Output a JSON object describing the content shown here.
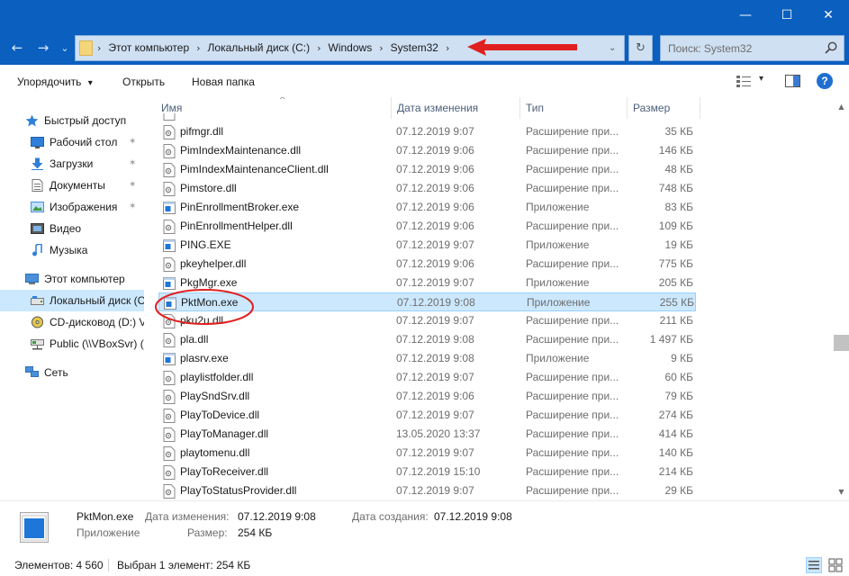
{
  "window": {
    "minimize_glyph": "—",
    "maximize_glyph": "☐",
    "close_glyph": "✕"
  },
  "nav": {
    "back_glyph": "←",
    "forward_glyph": "→",
    "recent_glyph": "⌄",
    "up_glyph": "↑"
  },
  "address": {
    "breadcrumbs": [
      "Этот компьютер",
      "Локальный диск (C:)",
      "Windows",
      "System32"
    ],
    "separator": "›",
    "dropdown_glyph": "⌄",
    "refresh_glyph": "↻"
  },
  "search": {
    "placeholder": "Поиск: System32"
  },
  "commands": {
    "organize": "Упорядочить",
    "organize_arrow": "▾",
    "open": "Открыть",
    "new_folder": "Новая папка",
    "view_arrow": "▾",
    "help_glyph": "?"
  },
  "sidebar": {
    "items": [
      {
        "label": "Быстрый доступ",
        "icon": "star-icon",
        "pinned": false
      },
      {
        "label": "Рабочий стол",
        "icon": "desktop-icon",
        "pinned": true
      },
      {
        "label": "Загрузки",
        "icon": "download-icon",
        "pinned": true
      },
      {
        "label": "Документы",
        "icon": "documents-icon",
        "pinned": true
      },
      {
        "label": "Изображения",
        "icon": "pictures-icon",
        "pinned": true
      },
      {
        "label": "Видео",
        "icon": "video-icon",
        "pinned": false
      },
      {
        "label": "Музыка",
        "icon": "music-icon",
        "pinned": false
      },
      {
        "label": "Этот компьютер",
        "icon": "computer-icon",
        "pinned": false
      },
      {
        "label": "Локальный диск (C:)",
        "icon": "drive-icon",
        "pinned": false,
        "selected": true
      },
      {
        "label": "CD-дисковод (D:) VirtualBox Guest Additions",
        "icon": "cd-drive-icon",
        "pinned": false
      },
      {
        "label": "Public (\\\\VBoxSvr) (E:)",
        "icon": "network-drive-icon",
        "pinned": false
      },
      {
        "label": "Сеть",
        "icon": "network-icon",
        "pinned": false
      }
    ],
    "pin_glyph": "📌"
  },
  "columns": {
    "name": "Имя",
    "date": "Дата изменения",
    "type": "Тип",
    "size": "Размер",
    "sort_glyph": "^"
  },
  "files": [
    {
      "name": "pifmgr.dll",
      "date": "07.12.2019 9:07",
      "type": "Расширение при...",
      "size": "35 КБ",
      "kind": "dll"
    },
    {
      "name": "PimIndexMaintenance.dll",
      "date": "07.12.2019 9:06",
      "type": "Расширение при...",
      "size": "146 КБ",
      "kind": "dll"
    },
    {
      "name": "PimIndexMaintenanceClient.dll",
      "date": "07.12.2019 9:06",
      "type": "Расширение при...",
      "size": "48 КБ",
      "kind": "dll"
    },
    {
      "name": "Pimstore.dll",
      "date": "07.12.2019 9:06",
      "type": "Расширение при...",
      "size": "748 КБ",
      "kind": "dll"
    },
    {
      "name": "PinEnrollmentBroker.exe",
      "date": "07.12.2019 9:06",
      "type": "Приложение",
      "size": "83 КБ",
      "kind": "exe"
    },
    {
      "name": "PinEnrollmentHelper.dll",
      "date": "07.12.2019 9:06",
      "type": "Расширение при...",
      "size": "109 КБ",
      "kind": "dll"
    },
    {
      "name": "PING.EXE",
      "date": "07.12.2019 9:07",
      "type": "Приложение",
      "size": "19 КБ",
      "kind": "exe"
    },
    {
      "name": "pkeyhelper.dll",
      "date": "07.12.2019 9:06",
      "type": "Расширение при...",
      "size": "775 КБ",
      "kind": "dll"
    },
    {
      "name": "PkgMgr.exe",
      "date": "07.12.2019 9:07",
      "type": "Приложение",
      "size": "205 КБ",
      "kind": "exe"
    },
    {
      "name": "PktMon.exe",
      "date": "07.12.2019 9:08",
      "type": "Приложение",
      "size": "255 КБ",
      "kind": "exe",
      "selected": true
    },
    {
      "name": "pku2u.dll",
      "date": "07.12.2019 9:07",
      "type": "Расширение при...",
      "size": "211 КБ",
      "kind": "dll"
    },
    {
      "name": "pla.dll",
      "date": "07.12.2019 9:08",
      "type": "Расширение при...",
      "size": "1 497 КБ",
      "kind": "dll"
    },
    {
      "name": "plasrv.exe",
      "date": "07.12.2019 9:08",
      "type": "Приложение",
      "size": "9 КБ",
      "kind": "exe"
    },
    {
      "name": "playlistfolder.dll",
      "date": "07.12.2019 9:07",
      "type": "Расширение при...",
      "size": "60 КБ",
      "kind": "dll"
    },
    {
      "name": "PlaySndSrv.dll",
      "date": "07.12.2019 9:06",
      "type": "Расширение при...",
      "size": "79 КБ",
      "kind": "dll"
    },
    {
      "name": "PlayToDevice.dll",
      "date": "07.12.2019 9:07",
      "type": "Расширение при...",
      "size": "274 КБ",
      "kind": "dll"
    },
    {
      "name": "PlayToManager.dll",
      "date": "13.05.2020 13:37",
      "type": "Расширение при...",
      "size": "414 КБ",
      "kind": "dll"
    },
    {
      "name": "playtomenu.dll",
      "date": "07.12.2019 9:07",
      "type": "Расширение при...",
      "size": "140 КБ",
      "kind": "dll"
    },
    {
      "name": "PlayToReceiver.dll",
      "date": "07.12.2019 15:10",
      "type": "Расширение при...",
      "size": "214 КБ",
      "kind": "dll"
    },
    {
      "name": "PlayToStatusProvider.dll",
      "date": "07.12.2019 9:07",
      "type": "Расширение при...",
      "size": "29 КБ",
      "kind": "dll"
    }
  ],
  "details": {
    "name": "PktMon.exe",
    "kind": "Приложение",
    "modified_label": "Дата изменения:",
    "modified_value": "07.12.2019 9:08",
    "created_label": "Дата создания:",
    "created_value": "07.12.2019 9:08",
    "size_label": "Размер:",
    "size_value": "254 КБ"
  },
  "status": {
    "count": "Элементов: 4 560",
    "selected": "Выбран 1 элемент: 254 КБ"
  },
  "colors": {
    "titlebar": "#0a5fbf",
    "selection": "#cce8ff",
    "annotation": "#e01f1f"
  }
}
